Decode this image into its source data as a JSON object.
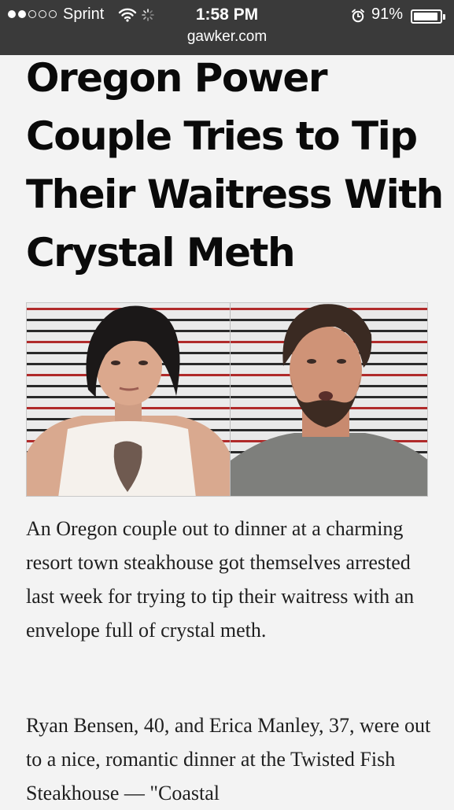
{
  "status_bar": {
    "carrier": "Sprint",
    "time": "1:58 PM",
    "battery_percent": "91%",
    "battery_level": 0.91,
    "signal_bars": 2,
    "signal_bars_max": 5,
    "icons": [
      "wifi-icon",
      "loading-spinner-icon",
      "alarm-icon",
      "battery-icon"
    ]
  },
  "browser": {
    "url": "gawker.com"
  },
  "article": {
    "headline": "Oregon Power Couple Tries to Tip Their Waitress With Crystal Meth",
    "image": {
      "description_icon": "mugshot-photo",
      "panels": [
        "woman-mugshot",
        "man-mugshot"
      ]
    },
    "paragraphs": [
      "An Oregon couple out to dinner at a charming resort town steakhouse got themselves arrested last week for trying to tip their waitress with an envelope full of crystal meth.",
      "Ryan Bensen, 40, and Erica Manley, 37, were out to a nice, romantic dinner at the Twisted Fish Steakhouse — \"Coastal"
    ]
  },
  "colors": {
    "status_bar_bg": "#3a3a3a",
    "page_bg": "#f3f3f3",
    "headline": "#0a0a0a",
    "body_text": "#1f1f1f"
  }
}
